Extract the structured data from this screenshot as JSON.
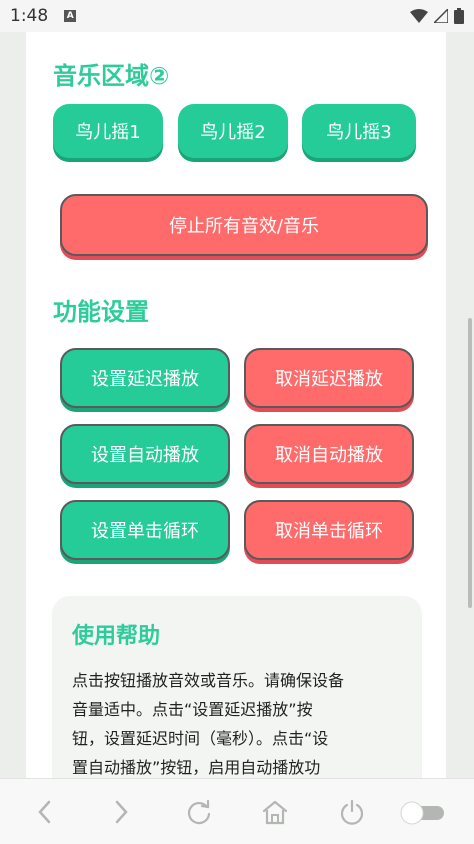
{
  "status_bar": {
    "time": "1:48",
    "notif_glyph": "A"
  },
  "music": {
    "title": "音乐区域②",
    "buttons": [
      "鸟儿摇1",
      "鸟儿摇2",
      "鸟儿摇3"
    ],
    "stop_label": "停止所有音效/音乐"
  },
  "functions": {
    "title": "功能设置",
    "set_delay": "设置延迟播放",
    "cancel_delay": "取消延迟播放",
    "set_auto": "设置自动播放",
    "cancel_auto": "取消自动播放",
    "set_loop": "设置单击循环",
    "cancel_loop": "取消单击循环"
  },
  "help": {
    "title": "使用帮助",
    "lines": [
      "点击按钮播放音效或音乐。请确保设备",
      "音量适中。点击“设置延迟播放”按",
      "钮，设置延迟时间（毫秒）。点击“设",
      "置自动播放”按钮，启用自动播放功"
    ]
  },
  "colors": {
    "accent": "#2ecc9a",
    "green": "#26cc98",
    "red": "#ff6b6b"
  },
  "nav_icons": [
    "back-icon",
    "forward-icon",
    "refresh-icon",
    "home-icon",
    "power-icon",
    "toggle-switch"
  ]
}
